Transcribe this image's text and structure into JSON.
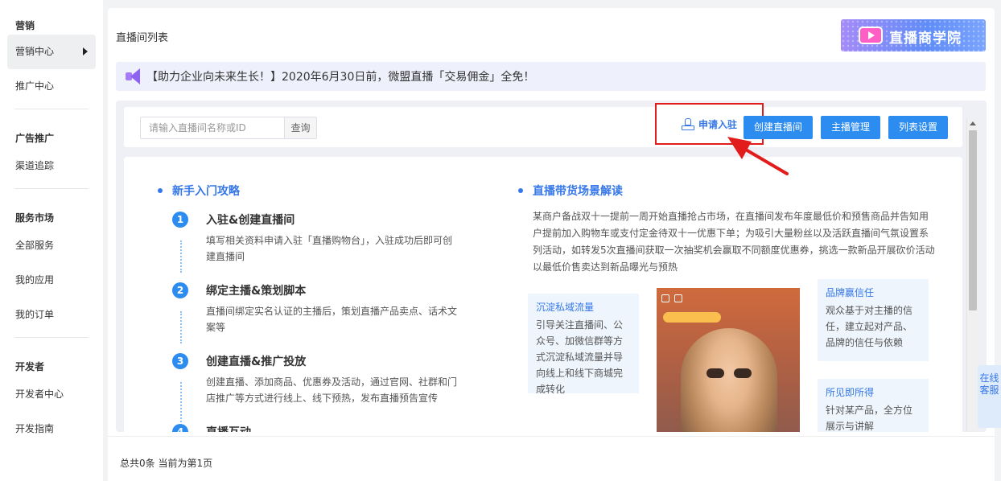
{
  "sidebar": {
    "sections": [
      {
        "title": "营销",
        "items": [
          {
            "label": "营销中心",
            "active": true
          },
          {
            "label": "推广中心"
          }
        ]
      },
      {
        "title": "广告推广",
        "items": [
          {
            "label": "渠道追踪"
          }
        ]
      },
      {
        "title": "服务市场",
        "items": [
          {
            "label": "全部服务"
          },
          {
            "label": "我的应用"
          },
          {
            "label": "我的订单"
          }
        ]
      },
      {
        "title": "开发者",
        "items": [
          {
            "label": "开发者中心"
          },
          {
            "label": "开发指南"
          }
        ]
      }
    ]
  },
  "header": {
    "title": "直播间列表",
    "academy_label": "直播商学院"
  },
  "notice": {
    "text": "【助力企业向未来生长！】2020年6月30日前，微盟直播「交易佣金」全免！"
  },
  "toolbar": {
    "search_placeholder": "请输入直播间名称或ID",
    "search_button": "查询",
    "apply_button": "申请入驻",
    "create_button": "创建直播间",
    "anchor_button": "主播管理",
    "settings_button": "列表设置"
  },
  "guide": {
    "title": "新手入门攻略",
    "steps": [
      {
        "num": "1",
        "title": "入驻&创建直播间",
        "desc": "填写相关资料申请入驻「直播购物台」，入驻成功后即可创建直播间"
      },
      {
        "num": "2",
        "title": "绑定主播&策划脚本",
        "desc": "直播间绑定实名认证的主播后，策划直播产品卖点、话术文案等"
      },
      {
        "num": "3",
        "title": "创建直播&推广投放",
        "desc": "创建直播、添加商品、优惠券及活动，通过官网、社群和门店推广等方式进行线上、线下预热，发布直播预告宣传"
      },
      {
        "num": "4",
        "title": "直播互动",
        "desc": ""
      }
    ]
  },
  "scene": {
    "title": "直播带货场景解读",
    "desc": "某商户备战双十一提前一周开始直播抢占市场，在直播间发布年度最低价和预售商品并告知用户提前加入购物车或支付定金待双十一优惠下单；为吸引大量粉丝以及活跃直播间气氛设置系列活动，如转发5次直播间获取一次抽奖机会赢取不同额度优惠券，挑选一款新品开展砍价活动以最低价售卖达到新品曝光与预热",
    "cards": {
      "private": {
        "title": "沉淀私域流量",
        "desc": "引导关注直播间、公众号、加微信群等方式沉淀私域流量并导向线上和线下商城完成转化"
      },
      "brand": {
        "title": "品牌赢信任",
        "desc": "观众基于对主播的信任，建立起对产品、品牌的信任与依赖"
      },
      "see": {
        "title": "所见即所得",
        "desc": "针对某产品，全方位展示与讲解"
      }
    }
  },
  "footer": {
    "text": "总共0条 当前为第1页"
  },
  "online_service": "在线客服",
  "colors": {
    "accent": "#2d8cf0",
    "highlight_box": "#e21b1b",
    "link": "#3577e8"
  }
}
